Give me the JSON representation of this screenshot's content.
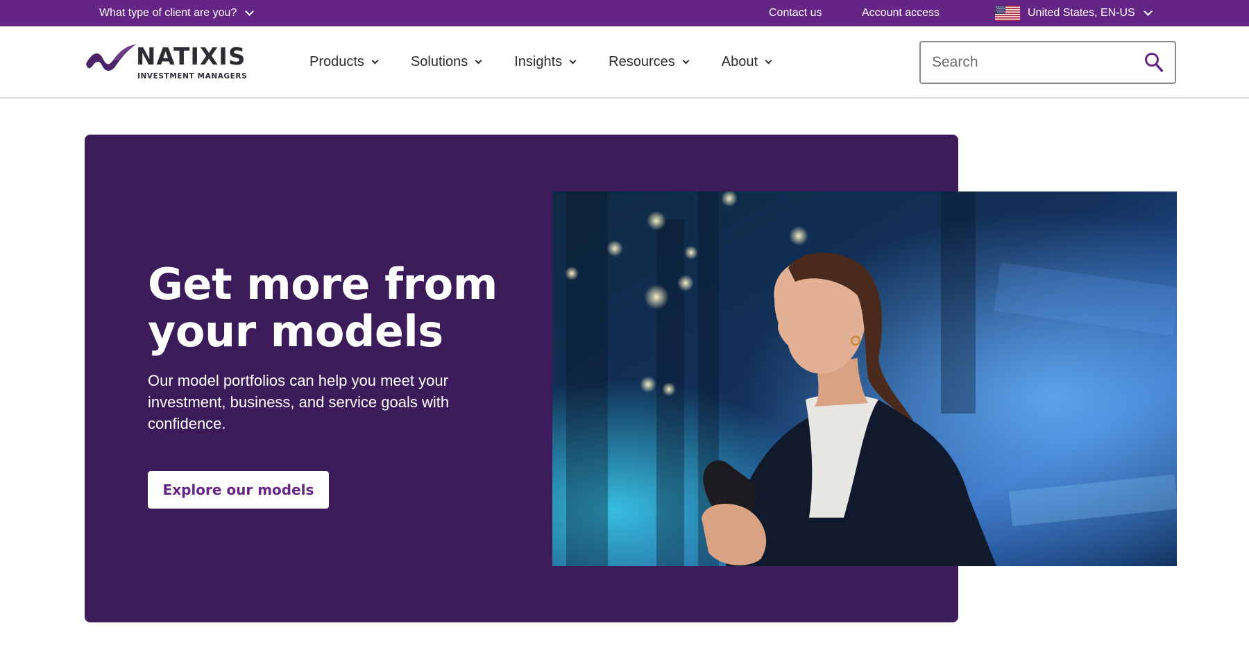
{
  "topbar": {
    "client_selector": "What type of client are you?",
    "contact": "Contact us",
    "account": "Account access",
    "locale": "United States, EN-US"
  },
  "brand": {
    "name": "NATIXIS",
    "tagline": "INVESTMENT MANAGERS",
    "colors": {
      "primary": "#642585",
      "hero_bg": "#3b1b59"
    }
  },
  "nav": {
    "items": [
      {
        "label": "Products"
      },
      {
        "label": "Solutions"
      },
      {
        "label": "Insights"
      },
      {
        "label": "Resources"
      },
      {
        "label": "About"
      }
    ]
  },
  "search": {
    "placeholder": "Search",
    "icon": "search-icon"
  },
  "hero": {
    "title": "Get more from your models",
    "description": "Our model portfolios can help you meet your investment, business, and service goals with confidence.",
    "cta": "Explore our models"
  }
}
